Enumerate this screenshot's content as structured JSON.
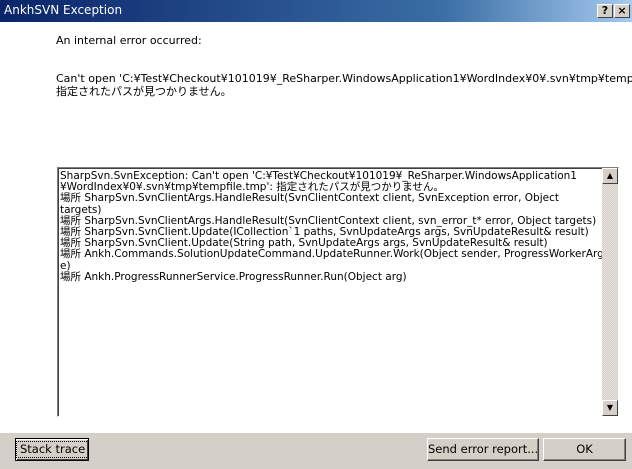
{
  "window": {
    "title": "AnkhSVN Exception",
    "help_glyph": "?",
    "close_glyph": "×"
  },
  "message": {
    "intro": "An internal error occurred:",
    "error_lines": [
      "Can't open 'C:¥Test¥Checkout¥101019¥_ReSharper.WindowsApplication1¥WordIndex¥0¥.svn¥tmp¥tempfile.tmp':",
      "指定されたパスが見つかりません。"
    ]
  },
  "stack_trace": {
    "lines": [
      "SharpSvn.SvnException: Can't open 'C:¥Test¥Checkout¥101019¥_ReSharper.WindowsApplication1",
      "¥WordIndex¥0¥.svn¥tmp¥tempfile.tmp': 指定されたパスが見つかりません。",
      "    場所 SharpSvn.SvnClientArgs.HandleResult(SvnClientContext client, SvnException error, Object",
      "targets)",
      "    場所 SharpSvn.SvnClientArgs.HandleResult(SvnClientContext client, svn_error_t* error, Object targets)",
      "    場所 SharpSvn.SvnClient.Update(ICollection`1 paths, SvnUpdateArgs args, SvnUpdateResult& result)",
      "    場所 SharpSvn.SvnClient.Update(String path, SvnUpdateArgs args, SvnUpdateResult& result)",
      "    場所 Ankh.Commands.SolutionUpdateCommand.UpdateRunner.Work(Object sender, ProgressWorkerArgs",
      "e)",
      "    場所 Ankh.ProgressRunnerService.ProgressRunner.Run(Object arg)"
    ],
    "scroll_up_glyph": "▲",
    "scroll_down_glyph": "▼"
  },
  "buttons": {
    "stack_trace": "Stack trace",
    "send_report": "Send error report...",
    "ok": "OK"
  }
}
